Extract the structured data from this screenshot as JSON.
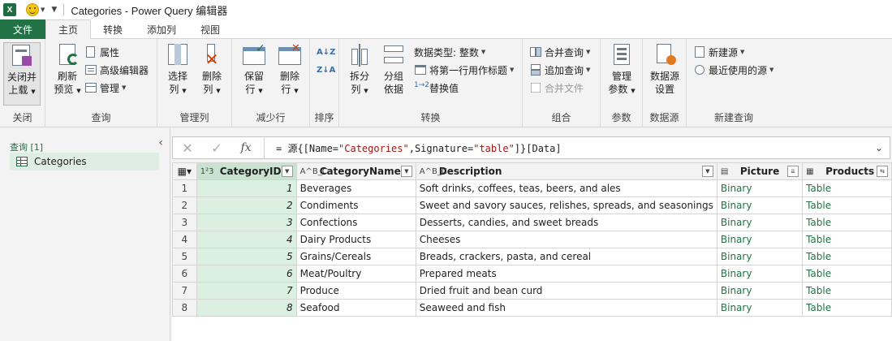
{
  "window": {
    "app_icon": "X",
    "title": "Categories - Power Query 编辑器"
  },
  "tabs": [
    {
      "label": "文件"
    },
    {
      "label": "主页"
    },
    {
      "label": "转换"
    },
    {
      "label": "添加列"
    },
    {
      "label": "视图"
    }
  ],
  "ribbon": {
    "close": {
      "label": "关闭",
      "close_load_line1": "关闭并",
      "close_load_line2": "上载"
    },
    "query": {
      "label": "查询",
      "refresh_line1": "刷新",
      "refresh_line2": "预览",
      "properties": "属性",
      "advanced_editor": "高级编辑器",
      "manage": "管理"
    },
    "manage_columns": {
      "label": "管理列",
      "choose_line1": "选择",
      "choose_line2": "列",
      "remove_line1": "删除",
      "remove_line2": "列"
    },
    "reduce_rows": {
      "label": "减少行",
      "keep_line1": "保留",
      "keep_line2": "行",
      "remove_line1": "删除",
      "remove_line2": "行"
    },
    "sort": {
      "label": "排序"
    },
    "transform": {
      "label": "转换",
      "split_line1": "拆分",
      "split_line2": "列",
      "group_line1": "分组",
      "group_line2": "依据",
      "data_type": "数据类型: 整数",
      "first_row_header": "将第一行用作标题",
      "replace_values": "替换值"
    },
    "combine": {
      "label": "组合",
      "merge_queries": "合并查询",
      "append_queries": "追加查询",
      "combine_files": "合并文件"
    },
    "parameters": {
      "label": "参数",
      "manage_line1": "管理",
      "manage_line2": "参数"
    },
    "data_sources": {
      "label": "数据源",
      "settings_line1": "数据源",
      "settings_line2": "设置"
    },
    "new_query": {
      "label": "新建查询",
      "new_source": "新建源",
      "recent_sources": "最近使用的源"
    }
  },
  "left_pane": {
    "header": "查询 [1]",
    "items": [
      {
        "label": "Categories"
      }
    ]
  },
  "formula_bar": {
    "fx": "fx",
    "prefix": "= 源{[Name=",
    "str1": "\"Categories\"",
    "mid": ",Signature=",
    "str2": "\"table\"",
    "suffix": "]}[Data]"
  },
  "grid": {
    "columns": [
      {
        "type_icon": "1²3",
        "name": "CategoryID"
      },
      {
        "type_icon": "A^B_C",
        "name": "CategoryName"
      },
      {
        "type_icon": "A^B_C",
        "name": "Description"
      },
      {
        "type_icon": "▤",
        "name": "Picture"
      },
      {
        "type_icon": "▦",
        "name": "Products"
      }
    ],
    "rows": [
      {
        "n": "1",
        "id": "1",
        "name": "Beverages",
        "desc": "Soft drinks, coffees, teas, beers, and ales",
        "picture": "Binary",
        "products": "Table"
      },
      {
        "n": "2",
        "id": "2",
        "name": "Condiments",
        "desc": "Sweet and savory sauces, relishes, spreads, and seasonings",
        "picture": "Binary",
        "products": "Table"
      },
      {
        "n": "3",
        "id": "3",
        "name": "Confections",
        "desc": "Desserts, candies, and sweet breads",
        "picture": "Binary",
        "products": "Table"
      },
      {
        "n": "4",
        "id": "4",
        "name": "Dairy Products",
        "desc": "Cheeses",
        "picture": "Binary",
        "products": "Table"
      },
      {
        "n": "5",
        "id": "5",
        "name": "Grains/Cereals",
        "desc": "Breads, crackers, pasta, and cereal",
        "picture": "Binary",
        "products": "Table"
      },
      {
        "n": "6",
        "id": "6",
        "name": "Meat/Poultry",
        "desc": "Prepared meats",
        "picture": "Binary",
        "products": "Table"
      },
      {
        "n": "7",
        "id": "7",
        "name": "Produce",
        "desc": "Dried fruit and bean curd",
        "picture": "Binary",
        "products": "Table"
      },
      {
        "n": "8",
        "id": "8",
        "name": "Seafood",
        "desc": "Seaweed and fish",
        "picture": "Binary",
        "products": "Table"
      }
    ]
  },
  "colors": {
    "accent": "#217346",
    "selected_column": "#dcf0e2"
  }
}
